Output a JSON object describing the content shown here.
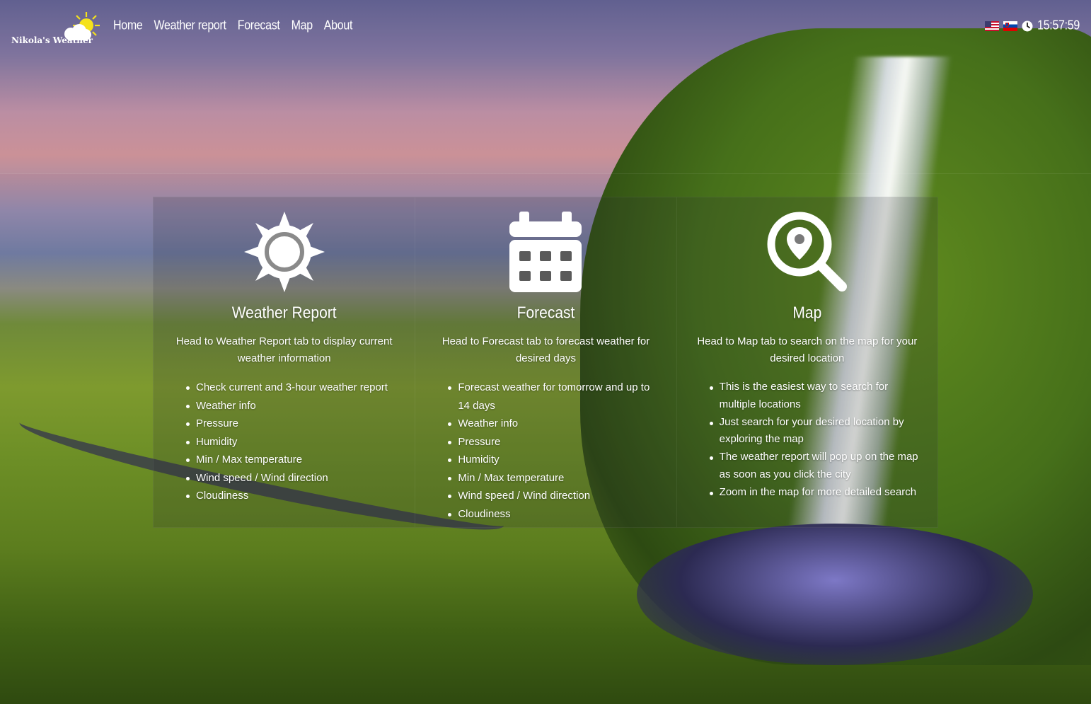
{
  "brand": {
    "name": "Nikola's Weather",
    "logo_icon": "sun-cloud-icon"
  },
  "nav": {
    "items": [
      {
        "label": "Home"
      },
      {
        "label": "Weather report"
      },
      {
        "label": "Forecast"
      },
      {
        "label": "Map"
      },
      {
        "label": "About"
      }
    ]
  },
  "header_right": {
    "languages": [
      {
        "icon": "us-flag-icon"
      },
      {
        "icon": "slovenia-flag-icon"
      }
    ],
    "clock_icon": "clock-icon",
    "time": "15:57:59"
  },
  "cards": [
    {
      "icon": "sun-icon",
      "title": "Weather Report",
      "description": "Head to Weather Report tab to display current weather information",
      "features": [
        "Check current and 3-hour weather report",
        "Weather info",
        "Pressure",
        "Humidity",
        "Min / Max temperature",
        "Wind speed / Wind direction",
        "Cloudiness"
      ]
    },
    {
      "icon": "calendar-icon",
      "title": "Forecast",
      "description": "Head to Forecast tab to forecast weather for desired days",
      "features": [
        "Forecast weather for tomorrow and up to 14 days",
        "Weather info",
        "Pressure",
        "Humidity",
        "Min / Max temperature",
        "Wind speed / Wind direction",
        "Cloudiness"
      ]
    },
    {
      "icon": "map-search-icon",
      "title": "Map",
      "description": "Head to Map tab to search on the map for your desired location",
      "features": [
        "This is the easiest way to search for multiple locations",
        "Just search for your desired location by exploring the map",
        "The weather report will pop up on the map as soon as you click the city",
        "Zoom in the map for more detailed search"
      ]
    }
  ],
  "colors": {
    "text": "#ffffff",
    "sun_yellow": "#f5e21b"
  }
}
